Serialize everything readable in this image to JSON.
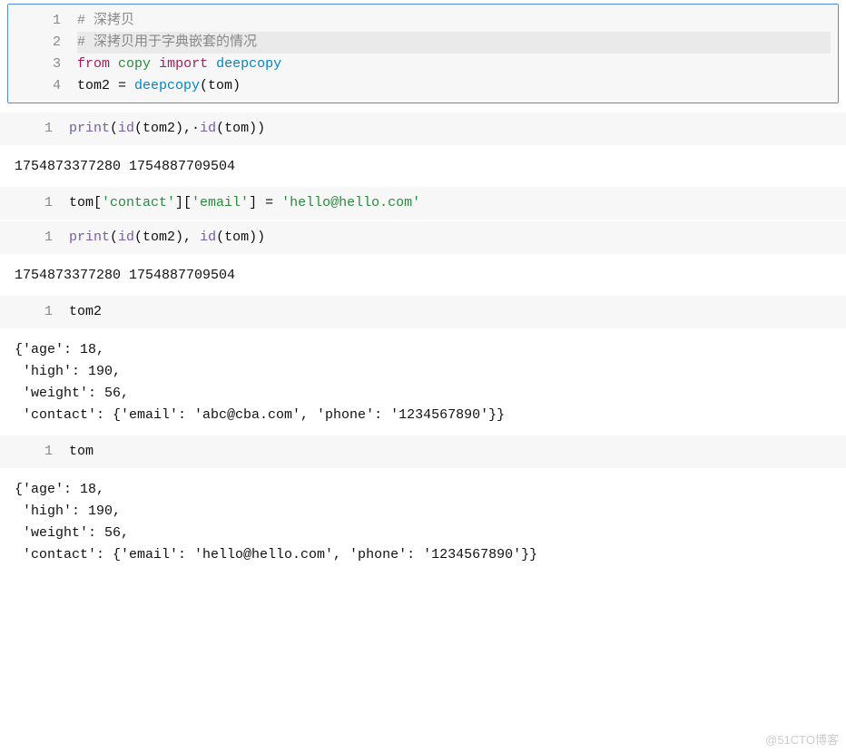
{
  "cell1": {
    "lines": [
      "1",
      "2",
      "3",
      "4"
    ],
    "l1_comment": "# 深拷贝",
    "l2_comment": "# 深拷贝用于字典嵌套的情况",
    "l3_from": "from",
    "l3_copy": "copy",
    "l3_import": "import",
    "l3_deepcopy": "deepcopy",
    "l4_tom2": "tom2",
    "l4_eq": " = ",
    "l4_deepcopy": "deepcopy",
    "l4_paren": "(tom)"
  },
  "cell2": {
    "line": "1",
    "print": "print",
    "args_open": "(",
    "id1": "id",
    "arg1": "(tom2),·",
    "id2": "id",
    "arg2": "(tom))"
  },
  "output2": "1754873377280 1754887709504",
  "cell3": {
    "line": "1",
    "tom": "tom[",
    "k1": "'contact'",
    "mid": "][",
    "k2": "'email'",
    "close": "] = ",
    "val": "'hello@hello.com'"
  },
  "cell4": {
    "line": "1",
    "print": "print",
    "open": "(",
    "id1": "id",
    "a1": "(tom2), ",
    "id2": "id",
    "a2": "(tom))"
  },
  "output4": "1754873377280 1754887709504",
  "cell5": {
    "line": "1",
    "code": "tom2"
  },
  "output5": "{'age': 18,\n 'high': 190,\n 'weight': 56,\n 'contact': {'email': 'abc@cba.com', 'phone': '1234567890'}}",
  "cell6": {
    "line": "1",
    "code": "tom"
  },
  "output6": "{'age': 18,\n 'high': 190,\n 'weight': 56,\n 'contact': {'email': 'hello@hello.com', 'phone': '1234567890'}}",
  "watermark": "@51CTO博客"
}
